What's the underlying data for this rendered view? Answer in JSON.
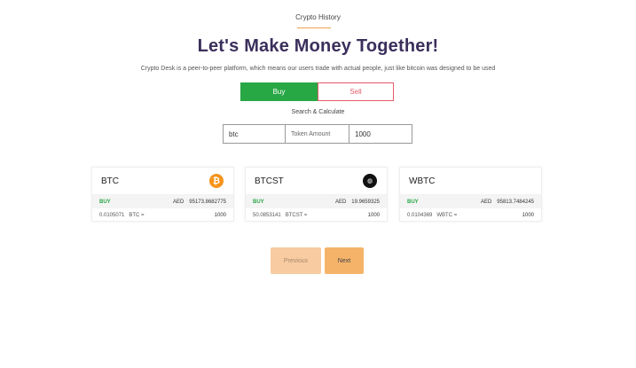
{
  "header": {
    "eyebrow": "Crypto History",
    "headline": "Let's Make Money Together!",
    "subtitle": "Crypto Desk is a peer-to-peer platform, which means our users trade with actual people, just like bitcoin was designed to be used"
  },
  "toggle": {
    "buy_label": "Buy",
    "sell_label": "Sell"
  },
  "search": {
    "label": "Search & Calculate",
    "coin_value": "btc",
    "amount_placeholder": "Token Amount",
    "amount_value": "1000"
  },
  "cards": [
    {
      "symbol": "BTC",
      "icon": "bitcoin-icon",
      "side": "BUY",
      "currency": "AED",
      "price": "95173.8682775",
      "rate": "0.0105071",
      "rate_symbol": "BTC =",
      "amount": "1000"
    },
    {
      "symbol": "BTCST",
      "icon": "btcst-icon",
      "side": "BUY",
      "currency": "AED",
      "price": "19.9659325",
      "rate": "50.0853141",
      "rate_symbol": "BTCST =",
      "amount": "1000"
    },
    {
      "symbol": "WBTC",
      "icon": "wbtc-icon",
      "side": "BUY",
      "currency": "AED",
      "price": "95813.7484245",
      "rate": "0.0104369",
      "rate_symbol": "WBTC =",
      "amount": "1000"
    }
  ],
  "pager": {
    "previous_label": "Previous",
    "next_label": "Next"
  },
  "colors": {
    "accent_orange": "#f0a24b",
    "buy_green": "#28a745",
    "sell_red": "#e35d6a",
    "headline_purple": "#3b2f5c"
  }
}
